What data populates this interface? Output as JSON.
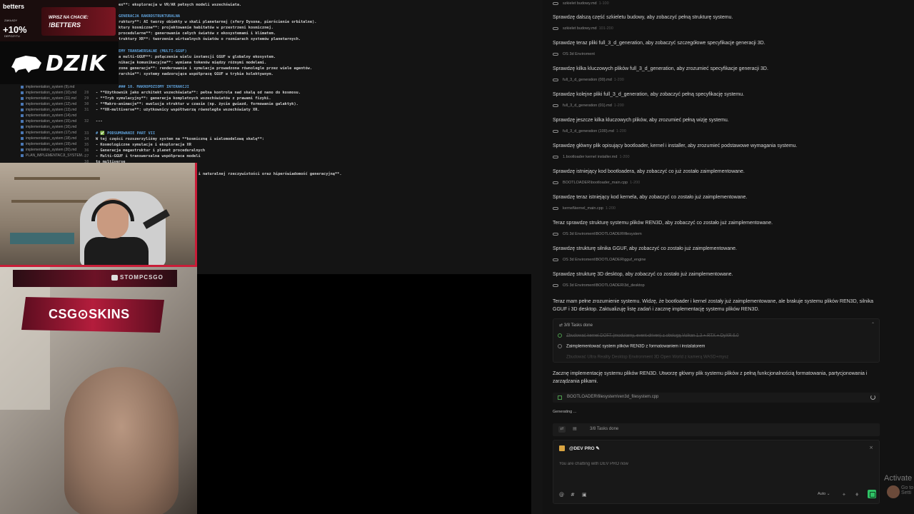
{
  "promo": {
    "brand": "betters",
    "small_top": "ZAKŁADY",
    "bonus": "+10%",
    "small_bottom": "DEPOZYTU",
    "cta_top": "WPISZ NA CHACIE:",
    "cta_code": "!BETTERS"
  },
  "dzik": {
    "logo": "DZIK"
  },
  "sidebar": {
    "files": [
      "implementation_system (9).md",
      "implementation_system (10).md",
      "implementation_system (11).md",
      "implementation_system (12).md",
      "implementation_system (13).md",
      "implementation_system (14).md",
      "implementation_system (15).md",
      "implementation_system (16).md",
      "implementation_system (17).md",
      "implementation_system (18).md",
      "implementation_system (19).md",
      "implementation_system (20).md",
      "PLAN_IMPLEMENTACJI_SYSTEM..."
    ]
  },
  "code": {
    "lines": [
      {
        "n": "",
        "t": "ex**: eksploracja w VR/AR pełnych modeli wszechświata."
      },
      {
        "n": "",
        "t": "GENERACJA RAKROSTRUKTURALNA"
      },
      {
        "n": "",
        "t": "ruktury**: AI tworzy obiekty w skali planetarnej (sfery Dysona, pierścienie orbitalne)."
      },
      {
        "n": "",
        "t": "ktury kosmiczne**: projektowanie habitatów w przestrzeni kosmicznej."
      },
      {
        "n": "",
        "t": "procedularne**: generowanie całych światów z ekosystemami i klimatem."
      },
      {
        "n": "",
        "t": "truktury XR**: tworzenie wirtualnych światów o rozmiarach systemów planetarnych."
      },
      {
        "n": "",
        "t": "EMY TRANSWERSALNE (MULTI-GGUF)"
      },
      {
        "n": "",
        "t": "a multi-GGUF**: połączenie wielu instancji GGUF w globalny ekosystem."
      },
      {
        "n": "",
        "t": "nikacja komunikacyjna**: wymiana tokenów między różnymi modelami."
      },
      {
        "n": "",
        "t": "zone generacje**: renderowanie i symulacja prowadzona równolegle przez wiele agentów."
      },
      {
        "n": "",
        "t": "rarchie**: systemy nadzorujące współpracę GGUF w trybie kolektywnym."
      },
      {
        "n": "",
        "t": "### 10. MAKROPOZIOMY INTERAKCJI"
      },
      {
        "n": "28",
        "t": "- **Użytkownik jako architekt wszechświata**: pełna kontrola nad skalą od nano do kosmosu."
      },
      {
        "n": "29",
        "t": "- **Tryb symulacyjny**: generacja kompletnych wszechświatów z prawami fizyki."
      },
      {
        "n": "30",
        "t": "- **Makro-animacje**: ewolucja struktur w czasie (np. życie gwiazd, formowanie galaktyk)."
      },
      {
        "n": "31",
        "t": "- **XR-multiverse**: użytkownicy współtworzą równoległe wszechświaty XR."
      },
      {
        "n": "32",
        "t": "---"
      },
      {
        "n": "33",
        "t": "# ✅ PODSUMOWANIE PART VII"
      },
      {
        "n": "34",
        "t": "W tej części rozszerzyliśmy system na **kosmiczną i wielomodelową skalę**:"
      },
      {
        "n": "35",
        "t": "- Kosmologiczne symulacje i eksploracja XR"
      },
      {
        "n": "36",
        "t": "- Generacja megastruktur i planet proceduralnych"
      },
      {
        "n": "37",
        "t": "- Multi-GGUF i transwersalna współpraca modeli"
      },
      {
        "n": "38",
        "t": "to multiverse"
      },
      {
        "n": "",
        "t": "ocyjnego modeli, syntezy sztucznej i naturalnej rzeczywistości oraz hiperświadomość generacyjną**."
      }
    ]
  },
  "stream": {
    "handle": "STOMPCSGO",
    "sponsor": "CSG⊙SKINS"
  },
  "chat": {
    "items": [
      {
        "kind": "ref",
        "text": "szkielet budowy.md",
        "dim": "1-100"
      },
      {
        "kind": "msg",
        "text": "Sprawdzę dalszą część szkieletu budowy, aby zobaczyć pełną strukturę systemu."
      },
      {
        "kind": "ref",
        "text": "szkielet budowy.md",
        "dim": "101-200"
      },
      {
        "kind": "msg",
        "text": "Sprawdzę teraz pliki full_3_d_generation, aby zobaczyć szczegółowe specyfikacje generacji 3D."
      },
      {
        "kind": "ref",
        "text": "OS 3d Enviroment",
        "dim": ""
      },
      {
        "kind": "msg",
        "text": "Sprawdzę kilka kluczowych plików full_3_d_generation, aby zrozumieć specyfikacje generacji 3D."
      },
      {
        "kind": "ref",
        "text": "full_3_d_generation (00).md",
        "dim": "1-200"
      },
      {
        "kind": "msg",
        "text": "Sprawdzę kolejne pliki full_3_d_generation, aby zobaczyć pełną specyfikację systemu."
      },
      {
        "kind": "ref",
        "text": "full_3_d_generation (01).md",
        "dim": "1-200"
      },
      {
        "kind": "msg",
        "text": "Sprawdzę jeszcze kilka kluczowych plików, aby zrozumieć pełną wizję systemu."
      },
      {
        "kind": "ref",
        "text": "full_3_d_generation (100).md",
        "dim": "1-200"
      },
      {
        "kind": "msg",
        "text": "Sprawdzę główny plik opisujący bootloader, kernel i installer, aby zrozumieć podstawowe wymagania systemu."
      },
      {
        "kind": "ref",
        "text": "1.bootloader kernel installer.md",
        "dim": "1-200"
      },
      {
        "kind": "msg",
        "text": "Sprawdzę istniejący kod bootloadera, aby zobaczyć co już zostało zaimplementowane."
      },
      {
        "kind": "ref",
        "text": "BOOTLOADER\\bootloader_main.cpp",
        "dim": "1-200"
      },
      {
        "kind": "msg",
        "text": "Sprawdzę teraz istniejący kod kernela, aby zobaczyć co zostało już zaimplementowane."
      },
      {
        "kind": "ref",
        "text": "kernel\\kernel_main.cpp",
        "dim": "1-200"
      },
      {
        "kind": "msg",
        "text": "Teraz sprawdzę strukturę systemu plików REN3D, aby zobaczyć co zostało już zaimplementowane."
      },
      {
        "kind": "ref",
        "text": "OS 3d Enviroment\\BOOTLOADER\\filesystem",
        "dim": ""
      },
      {
        "kind": "msg",
        "text": "Sprawdzę strukturę silnika GGUF, aby zobaczyć co zostało już zaimplementowane."
      },
      {
        "kind": "ref",
        "text": "OS 3d Enviroment\\BOOTLOADER\\gguf_engine",
        "dim": ""
      },
      {
        "kind": "msg",
        "text": "Sprawdzę strukturę 3D desktop, aby zobaczyć co zostało już zaimplementowane."
      },
      {
        "kind": "ref",
        "text": "OS 3d Enviroment\\BOOTLOADER\\3d_desktop",
        "dim": ""
      }
    ],
    "summary": "Teraz mam pełne zrozumienie systemu. Widzę, że bootloader i kernel zostały już zaimplementowane, ale brakuje systemu plików REN3D, silnika GGUF i 3D desktop. Zaktualizuję listę zadań i zacznę implementację systemu plików REN3D.",
    "tasks": {
      "header": "3/8 Tasks done",
      "items": [
        {
          "state": "done",
          "text": "Zbudować kernel DOFT (modularny, event-driven) z obsługą Vulkan 1.3 + RTX + DyXR 6.0"
        },
        {
          "state": "current",
          "text": "Zaimplementować system plików REN3D z formatowaniem i instalatorem"
        },
        {
          "state": "pending",
          "text": "Zbudować Ultra Reality Desktop Environment 3D Open World z kamerą WASD+mysz"
        }
      ]
    },
    "next": "Zacznę implementację systemu plików REN3D. Utworzę główny plik systemu plików z pełną funkcjonalnością formatowania, partycjonowania i zarządzania plikami.",
    "file": "BOOTLOADER\\filesystem\\ren3d_filesystem.cpp",
    "generating": "Generating ...",
    "bar_tasks": "3/8 Tasks done",
    "agent": "@DEV PRO",
    "placeholder": "You are chatting with DEV PRO now",
    "auto": "Auto"
  },
  "watermark": {
    "activate": "Activate",
    "settings": "Go to Setti"
  }
}
